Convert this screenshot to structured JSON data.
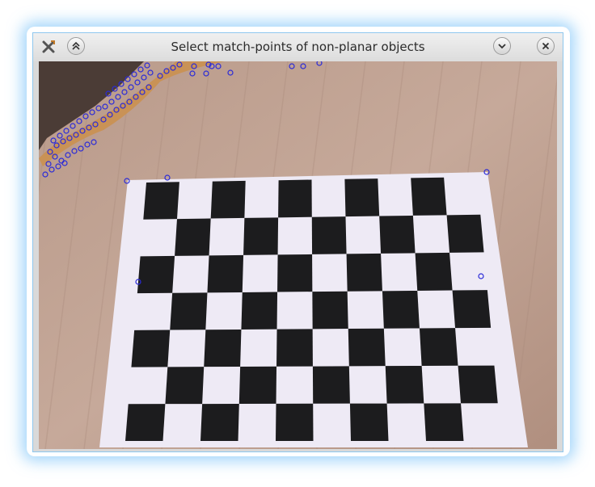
{
  "window": {
    "title": "Select match-points of non-planar objects",
    "icons": {
      "app": "app-icon",
      "shade": "shade-up-icon",
      "minimize": "minimize-icon",
      "close": "close-icon"
    },
    "accent_color": "#8ec7ee"
  },
  "camera_view": {
    "match_point_color": "#2a2ad8",
    "board_rows": 7,
    "board_cols": 10
  }
}
